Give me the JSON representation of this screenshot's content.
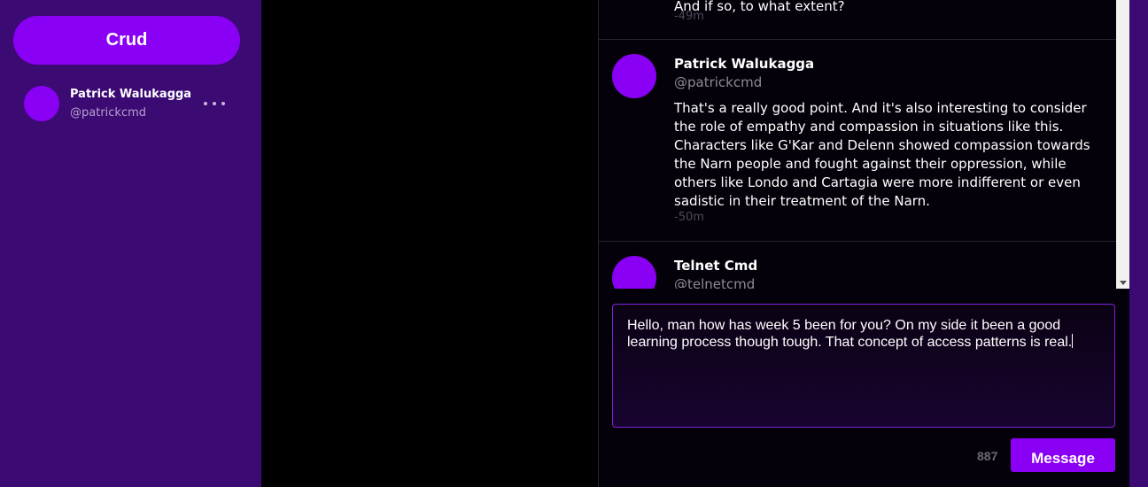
{
  "brand": {
    "label": "Crud"
  },
  "account": {
    "name": "Patrick Walukagga",
    "handle": "@patrickcmd"
  },
  "messages": [
    {
      "name": "",
      "handle": "",
      "body": "And if so, to what extent?",
      "time": "-49m"
    },
    {
      "name": "Patrick Walukagga",
      "handle": "@patrickcmd",
      "body": "That's a really good point. And it's also interesting to consider the role of empathy and compassion in situations like this. Characters like G'Kar and Delenn showed compassion towards the Narn people and fought against their oppression, while others like Londo and Cartagia were more indifferent or even sadistic in their treatment of the Narn.",
      "time": "-50m"
    },
    {
      "name": "Telnet Cmd",
      "handle": "@telnetcmd",
      "body": "",
      "time": ""
    }
  ],
  "composer": {
    "text": "Hello, man how has week 5 been for you? On my side it been a good learning process though tough. That concept of access patterns is real.",
    "remaining": "887",
    "send_label": "Message"
  },
  "colors": {
    "accent": "#8a00f5",
    "sidebar": "#3b0a73",
    "panel": "#05010a"
  },
  "icons": {
    "more": "more-horizontal-icon",
    "scroll": "scroll-down-arrow-icon"
  }
}
